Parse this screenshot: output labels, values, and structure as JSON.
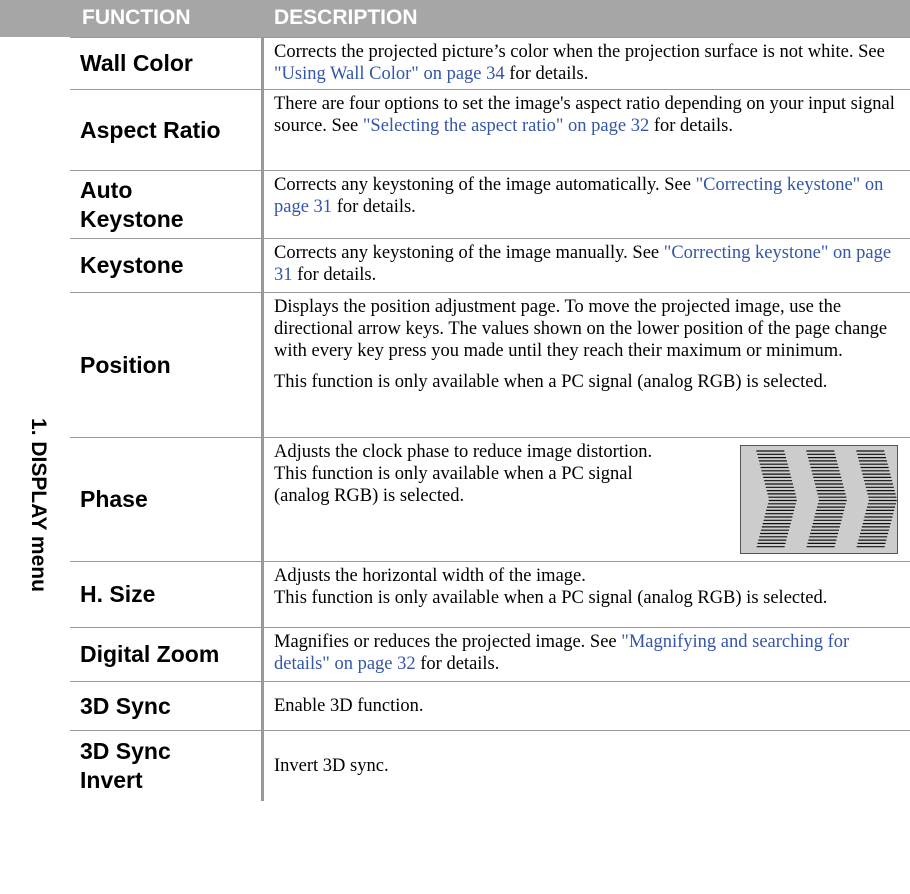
{
  "header": {
    "function_label": "FUNCTION",
    "description_label": "DESCRIPTION",
    "background": "#a6a6a6"
  },
  "side_label": "1. DISPLAY menu",
  "link_color": "#3355aa",
  "rows": [
    {
      "function": "Wall Color",
      "desc": [
        "Corrects the projected picture’s color when the projection surface is not white. See ",
        "\"Using Wall Color\" on page 34",
        " for details."
      ]
    },
    {
      "function": "Aspect Ratio",
      "desc": [
        "There are four options to set the image's aspect ratio depending on your input signal source. See ",
        "\"Selecting the aspect ratio\" on page 32",
        " for details."
      ]
    },
    {
      "function": "Auto Keystone",
      "desc": [
        "Corrects any keystoning of the image automatically. See ",
        "\"Correcting keystone\" on page 31",
        " for details."
      ]
    },
    {
      "function": "Keystone",
      "desc": [
        "Corrects any keystoning of the image manually. See ",
        "\"Correcting keystone\" on page 31",
        " for details."
      ]
    },
    {
      "function": "Position",
      "paragraphs": [
        "Displays the position adjustment page. To move the projected image, use the directional arrow keys. The values shown on the lower position of the page change with every key press you made until they reach their maximum or minimum.",
        "This function is only available when a PC signal (analog RGB) is selected."
      ]
    },
    {
      "function": "Phase",
      "paragraphs": [
        "Adjusts the clock phase to reduce image distortion.",
        "This function is only available when a PC signal (analog RGB) is selected."
      ],
      "image_icon": "phase-distortion-pattern-icon"
    },
    {
      "function": "H. Size",
      "paragraphs": [
        "Adjusts the horizontal width of the image.",
        "This function is only available when a PC signal (analog RGB) is selected."
      ]
    },
    {
      "function": "Digital Zoom",
      "desc": [
        "Magnifies or reduces the projected image. See ",
        "\"Magnifying and searching for details\" on page 32",
        " for details."
      ]
    },
    {
      "function": "3D Sync",
      "text": "Enable 3D function."
    },
    {
      "function": "3D Sync Invert",
      "text": "Invert 3D sync."
    }
  ]
}
